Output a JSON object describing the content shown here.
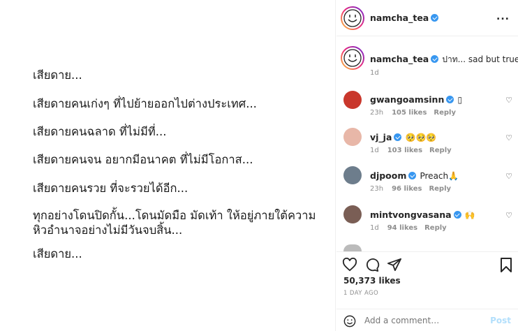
{
  "post_image": {
    "lines": [
      "เสียดาย...",
      "เสียดายคนเก่งๆ ที่ไปย้ายออกไปต่างประเทศ...",
      "เสียดายคนฉลาด ที่ไม่มีที่...",
      "เสียดายคนจน อยากมีอนาคต ที่ไม่มีโอกาส...",
      "เสียดายคนรวย ที่จะรวยได้อีก...",
      "ทุกอย่างโดนปิดกั้น...โดนมัดมือ มัดเท้า ให้อยู่ภายใต้ความ",
      "หิวอำนาจอย่างไม่มีวันจบสิ้น...",
      "เสียดาย..."
    ]
  },
  "header": {
    "username": "namcha_tea",
    "more": "..."
  },
  "caption": {
    "username": "namcha_tea",
    "text": "ปาท... sad but true...",
    "time": "1d"
  },
  "comments": [
    {
      "username": "gwangoamsinn",
      "text": "▯",
      "time": "23h",
      "likes": "105 likes",
      "reply": "Reply",
      "avatar_color": "#c9372c"
    },
    {
      "username": "vj_ja",
      "text": "🥺🥺🥺",
      "time": "1d",
      "likes": "103 likes",
      "reply": "Reply",
      "avatar_color": "#e8b7a8"
    },
    {
      "username": "djpoom",
      "text": "Preach🙏",
      "time": "23h",
      "likes": "96 likes",
      "reply": "Reply",
      "avatar_color": "#6d7d8c"
    },
    {
      "username": "mintvongvasana",
      "text": "🙌",
      "time": "1d",
      "likes": "94 likes",
      "reply": "Reply",
      "avatar_color": "#7a5e55"
    }
  ],
  "actions": {
    "likes": "50,373 likes",
    "time_ago": "1 DAY AGO",
    "add_comment_placeholder": "Add a comment…",
    "post_label": "Post"
  }
}
